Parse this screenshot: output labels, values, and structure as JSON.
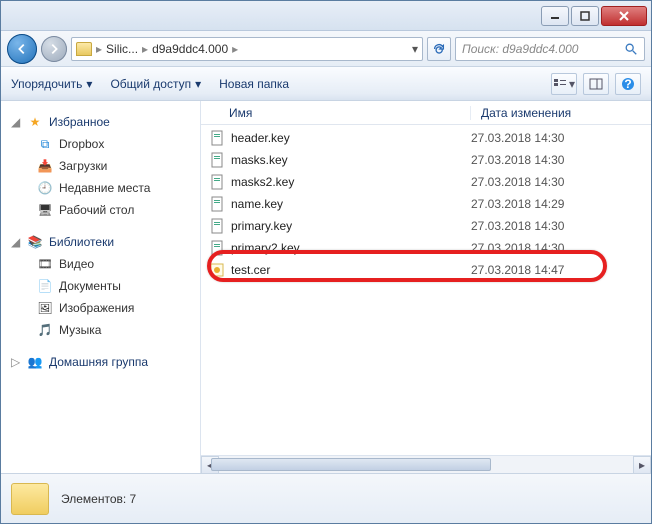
{
  "address": {
    "seg1": "Silic...",
    "seg2": "d9a9ddc4.000"
  },
  "search": {
    "placeholder": "Поиск: d9a9ddc4.000"
  },
  "toolbar": {
    "organize": "Упорядочить",
    "share": "Общий доступ",
    "newfolder": "Новая папка"
  },
  "columns": {
    "name": "Имя",
    "modified": "Дата изменения"
  },
  "sidebar": {
    "favorites": {
      "label": "Избранное",
      "items": [
        "Dropbox",
        "Загрузки",
        "Недавние места",
        "Рабочий стол"
      ]
    },
    "libraries": {
      "label": "Библиотеки",
      "items": [
        "Видео",
        "Документы",
        "Изображения",
        "Музыка"
      ]
    },
    "homegroup": {
      "label": "Домашняя группа"
    }
  },
  "files": [
    {
      "name": "header.key",
      "date": "27.03.2018 14:30",
      "type": "key"
    },
    {
      "name": "masks.key",
      "date": "27.03.2018 14:30",
      "type": "key"
    },
    {
      "name": "masks2.key",
      "date": "27.03.2018 14:30",
      "type": "key"
    },
    {
      "name": "name.key",
      "date": "27.03.2018 14:29",
      "type": "key"
    },
    {
      "name": "primary.key",
      "date": "27.03.2018 14:30",
      "type": "key"
    },
    {
      "name": "primary2.key",
      "date": "27.03.2018 14:30",
      "type": "key"
    },
    {
      "name": "test.cer",
      "date": "27.03.2018 14:47",
      "type": "cer"
    }
  ],
  "status": {
    "text": "Элементов: 7"
  }
}
